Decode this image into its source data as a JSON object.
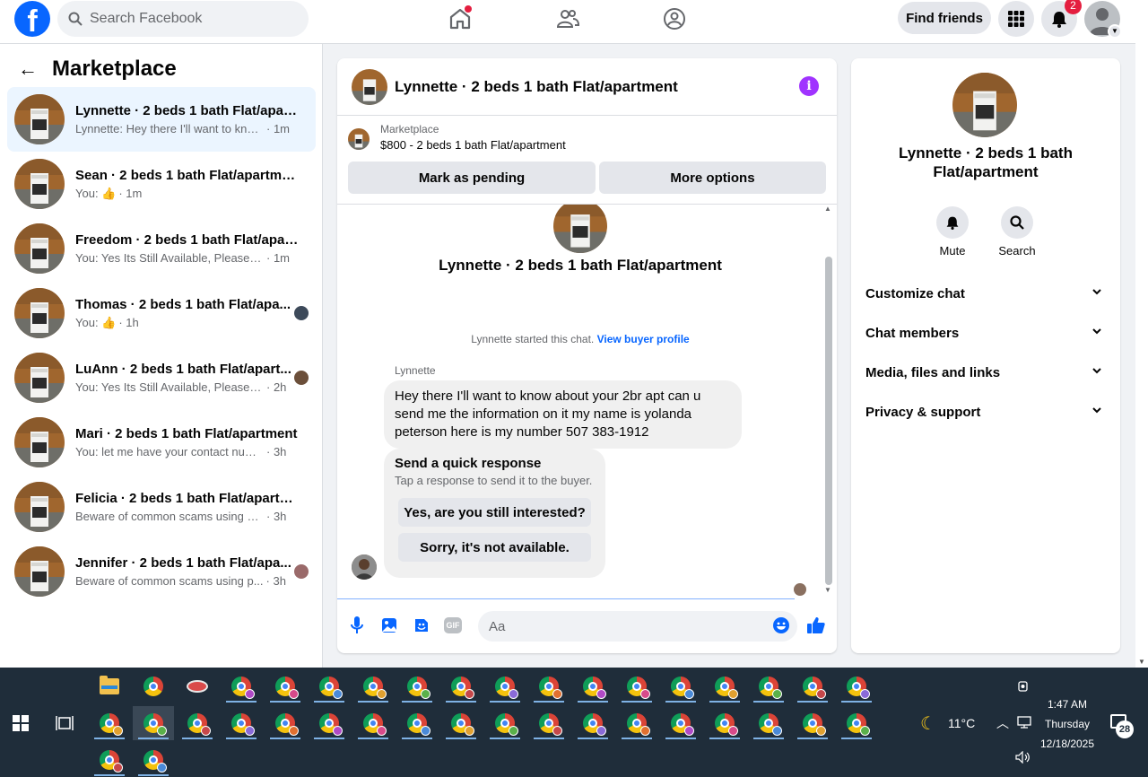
{
  "topbar": {
    "logo_text": "f",
    "search_placeholder": "Search Facebook",
    "find_friends": "Find friends",
    "notification_count": "2"
  },
  "sidebar": {
    "title": "Marketplace",
    "conversations": [
      {
        "name": "Lynnette · 2 beds 1 bath Flat/apart...",
        "preview": "Lynnette: Hey there I'll want to know ...",
        "time": "· 1m",
        "active": true
      },
      {
        "name": "Sean · 2 beds 1 bath Flat/apartment",
        "preview": "You: 👍",
        "time": "· 1m"
      },
      {
        "name": "Freedom · 2 beds 1 bath Flat/apart...",
        "preview": "You: Yes Its Still Available, Please Sen...",
        "time": "· 1m"
      },
      {
        "name": "Thomas · 2 beds 1 bath Flat/apa...",
        "preview": "You: 👍",
        "time": "· 1h"
      },
      {
        "name": "LuAnn · 2 beds 1 bath Flat/apart...",
        "preview": "You: Yes Its Still Available, Please Se...",
        "time": "· 2h"
      },
      {
        "name": "Mari · 2 beds 1 bath Flat/apartment",
        "preview": "You: let me have your contact number...",
        "time": "· 3h"
      },
      {
        "name": "Felicia · 2 beds 1 bath Flat/apartm...",
        "preview": "Beware of common scams using pay...",
        "time": "· 3h"
      },
      {
        "name": "Jennifer · 2 beds 1 bath Flat/apa...",
        "preview": "Beware of common scams using p...",
        "time": "· 3h"
      }
    ]
  },
  "chat": {
    "title": "Lynnette · 2 beds 1 bath Flat/apartment",
    "listing_source": "Marketplace",
    "listing_price": "$800 - 2 beds 1 bath Flat/apartment",
    "mark_pending": "Mark as pending",
    "more_options": "More options",
    "started_text": "Lynnette started this chat.",
    "view_profile": "View buyer profile",
    "sender": "Lynnette",
    "message": "Hey there I'll want to know about your 2br apt can u send me the information on it my name is yolanda peterson here is my number 507 383-1912",
    "quick_title": "Send a quick response",
    "quick_sub": "Tap a response to send it to the buyer.",
    "quick_1": "Yes, are you still interested?",
    "quick_2": "Sorry, it's not available.",
    "input_placeholder": "Aa",
    "gif_label": "GIF"
  },
  "right_panel": {
    "name": "Lynnette · 2 beds 1 bath Flat/apartment",
    "mute": "Mute",
    "search": "Search",
    "sections": [
      "Customize chat",
      "Chat members",
      "Media, files and links",
      "Privacy & support"
    ]
  },
  "taskbar": {
    "temperature": "11°C",
    "time": "1:47 AM",
    "day": "Thursday",
    "date": "12/18/2025",
    "notification_count": "28"
  },
  "colors": {
    "facebook_blue": "#0866ff",
    "messenger_purple": "#a033ff",
    "active_bg": "#ebf5ff",
    "taskbar_bg": "#1f2d3a"
  }
}
